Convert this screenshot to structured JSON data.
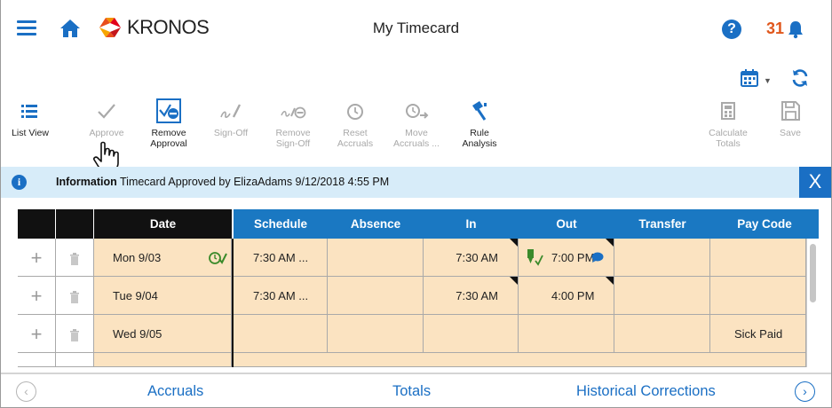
{
  "header": {
    "logo_text": "KRONOS",
    "title": "My Timecard",
    "notifications_count": "31"
  },
  "toolbar": [
    {
      "label": "List View",
      "enabled": true
    },
    {
      "label": "Approve",
      "enabled": false
    },
    {
      "label": "Remove Approval",
      "enabled": true
    },
    {
      "label": "Sign-Off",
      "enabled": false
    },
    {
      "label": "Remove Sign-Off",
      "enabled": false
    },
    {
      "label": "Reset Accruals",
      "enabled": false
    },
    {
      "label": "Move Accruals ...",
      "enabled": false
    },
    {
      "label": "Rule Analysis",
      "enabled": true
    },
    {
      "label": "Calculate Totals",
      "enabled": false
    },
    {
      "label": "Save",
      "enabled": false
    }
  ],
  "banner": {
    "bold": "Information",
    "message": " Timecard Approved by ElizaAdams 9/12/2018 4:55 PM",
    "close_label": "X"
  },
  "grid": {
    "columns": [
      "Date",
      "Schedule",
      "Absence",
      "In",
      "Out",
      "Transfer",
      "Pay Code"
    ],
    "rows": [
      {
        "date": "Mon 9/03",
        "schedule": "7:30 AM ...",
        "absence": "",
        "in": "7:30 AM",
        "out": "7:00 PM",
        "transfer": "",
        "paycode": ""
      },
      {
        "date": "Tue 9/04",
        "schedule": "7:30 AM ...",
        "absence": "",
        "in": "7:30 AM",
        "out": "4:00 PM",
        "transfer": "",
        "paycode": ""
      },
      {
        "date": "Wed 9/05",
        "schedule": "",
        "absence": "",
        "in": "",
        "out": "",
        "transfer": "",
        "paycode": "Sick Paid"
      }
    ]
  },
  "bottom_nav": {
    "accruals": "Accruals",
    "totals": "Totals",
    "historical": "Historical Corrections"
  },
  "colors": {
    "primary_blue": "#1a6fc4",
    "header_blue": "#1a78c2",
    "cell_tan": "#fbe3c1",
    "banner_bg": "#d7ecf9",
    "alert_orange": "#e0571c"
  }
}
